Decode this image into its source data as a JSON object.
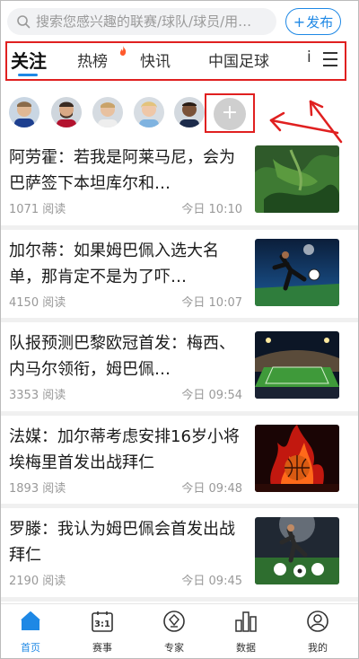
{
  "search": {
    "placeholder": "搜索您感兴趣的联赛/球队/球员/用…"
  },
  "publish": {
    "label": "发布"
  },
  "tabs": [
    {
      "label": "关注",
      "active": true
    },
    {
      "label": "热榜",
      "hot": true
    },
    {
      "label": "快讯"
    },
    {
      "label": "中国足球"
    },
    {
      "label": "i"
    }
  ],
  "followed_players": [
    {
      "name": "player-1"
    },
    {
      "name": "player-2"
    },
    {
      "name": "player-3"
    },
    {
      "name": "player-4"
    },
    {
      "name": "player-5"
    }
  ],
  "add_follow": {
    "label": "+"
  },
  "feed": [
    {
      "title": "阿劳霍：若我是阿莱马尼，会为巴萨签下本坦库尔和…",
      "reads": "1071 阅读",
      "time": "今日 10:10",
      "thumb": "aerial-green"
    },
    {
      "title": "加尔蒂：如果姆巴佩入选大名单，那肯定不是为了吓…",
      "reads": "4150 阅读",
      "time": "今日 10:07",
      "thumb": "soccer-kick"
    },
    {
      "title": "队报预测巴黎欧冠首发：梅西、内马尔领衔，姆巴佩…",
      "reads": "3353 阅读",
      "time": "今日 09:54",
      "thumb": "stadium"
    },
    {
      "title": "法媒：加尔蒂考虑安排16岁小将埃梅里首发出战拜仁",
      "reads": "1893 阅读",
      "time": "今日 09:48",
      "thumb": "fire-ball"
    },
    {
      "title": "罗滕：我认为姆巴佩会首发出战拜仁",
      "reads": "2190 阅读",
      "time": "今日 09:45",
      "thumb": "field-player"
    }
  ],
  "bottom_nav": [
    {
      "label": "首页",
      "icon": "home-icon",
      "active": true
    },
    {
      "label": "赛事",
      "icon": "calendar-icon",
      "badge": "3:1"
    },
    {
      "label": "专家",
      "icon": "expert-icon"
    },
    {
      "label": "数据",
      "icon": "data-icon"
    },
    {
      "label": "我的",
      "icon": "profile-icon"
    }
  ],
  "colors": {
    "accent": "#1e88e5",
    "highlight": "#e02020"
  }
}
